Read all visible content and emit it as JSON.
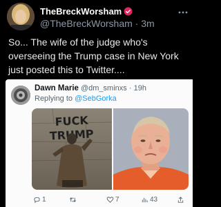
{
  "tweet": {
    "display_name": "TheBreckWorsham",
    "handle": "@TheBreckWorsham",
    "separator": "·",
    "time": "3m",
    "text": "So... The wife of the judge who's overseeing the Trump case in New York just posted this to Twitter...."
  },
  "quoted": {
    "display_name": "Dawn Marie",
    "handle": "@dm_sminxs",
    "separator": "·",
    "time": "19h",
    "replying_prefix": "Replying to",
    "replying_mention": "@SebGorka",
    "graffiti_text": "FUCK TRUMP",
    "actions": {
      "replies": "1",
      "retweets": "",
      "likes": "7",
      "views": "43"
    }
  },
  "colors": {
    "background": "#000000",
    "verified": "#e0245e",
    "link": "#1d9bf0",
    "card": "#fbfbfb"
  }
}
